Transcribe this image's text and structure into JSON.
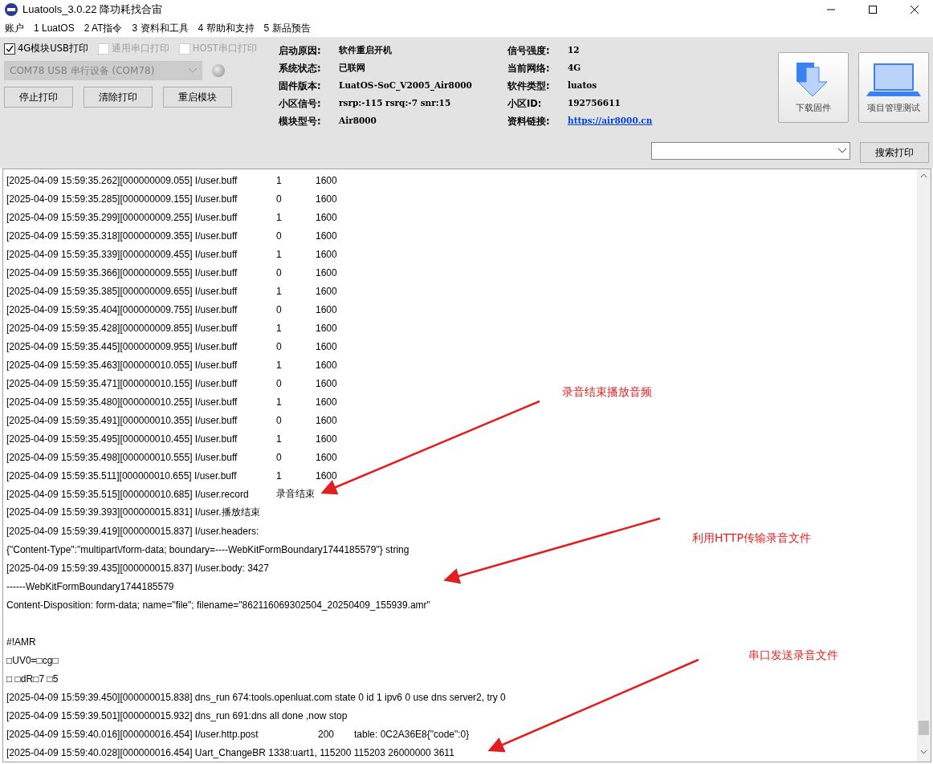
{
  "window": {
    "title": "Luatools_3.0.22 降功耗找合宙"
  },
  "menu": [
    "账户",
    "1 LuatOS",
    "2 AT指令",
    "3 资料和工具",
    "4 帮助和支持",
    "5 新品预告"
  ],
  "print_options": [
    {
      "label": "4G模块USB打印",
      "checked": true,
      "disabled": false
    },
    {
      "label": "通用串口打印",
      "checked": false,
      "disabled": true
    },
    {
      "label": "HOST串口打印",
      "checked": false,
      "disabled": true
    }
  ],
  "port_select": {
    "value": "COM78 USB 串行设备 (COM78)",
    "disabled": true
  },
  "buttons": [
    "停止打印",
    "清除打印",
    "重启模块"
  ],
  "info_left": [
    {
      "label": "启动原因:",
      "value": "软件重启开机"
    },
    {
      "label": "系统状态:",
      "value": "已联网"
    },
    {
      "label": "固件版本:",
      "value": "LuatOS-SoC_V2005_Air8000"
    },
    {
      "label": "小区信号:",
      "value": "rsrp:-115 rsrq:-7 snr:15"
    },
    {
      "label": "模块型号:",
      "value": "Air8000"
    }
  ],
  "info_right": [
    {
      "label": "信号强度:",
      "value": "12",
      "kind": "text"
    },
    {
      "label": "当前网络:",
      "value": "4G",
      "kind": "text"
    },
    {
      "label": "软件类型:",
      "value": "luatos",
      "kind": "text"
    },
    {
      "label": "小区ID:",
      "value": "192756611",
      "kind": "text"
    },
    {
      "label": "资料链接:",
      "value": "https://air8000.cn",
      "kind": "link"
    }
  ],
  "tool_buttons": [
    {
      "label": "下载固件",
      "kind": "download"
    },
    {
      "label": "项目管理测试",
      "kind": "laptop"
    }
  ],
  "search_button": "搜索打印",
  "log": [
    {
      "kind": "cols",
      "cells": [
        "[2025-04-09 15:59:35.262][000000009.055] I/user.buff",
        "1",
        "1600"
      ]
    },
    {
      "kind": "cols",
      "cells": [
        "[2025-04-09 15:59:35.285][000000009.155] I/user.buff",
        "0",
        "1600"
      ]
    },
    {
      "kind": "cols",
      "cells": [
        "[2025-04-09 15:59:35.299][000000009.255] I/user.buff",
        "1",
        "1600"
      ]
    },
    {
      "kind": "cols",
      "cells": [
        "[2025-04-09 15:59:35.318][000000009.355] I/user.buff",
        "0",
        "1600"
      ]
    },
    {
      "kind": "cols",
      "cells": [
        "[2025-04-09 15:59:35.339][000000009.455] I/user.buff",
        "1",
        "1600"
      ]
    },
    {
      "kind": "cols",
      "cells": [
        "[2025-04-09 15:59:35.366][000000009.555] I/user.buff",
        "0",
        "1600"
      ]
    },
    {
      "kind": "cols",
      "cells": [
        "[2025-04-09 15:59:35.385][000000009.655] I/user.buff",
        "1",
        "1600"
      ]
    },
    {
      "kind": "cols",
      "cells": [
        "[2025-04-09 15:59:35.404][000000009.755] I/user.buff",
        "0",
        "1600"
      ]
    },
    {
      "kind": "cols",
      "cells": [
        "[2025-04-09 15:59:35.428][000000009.855] I/user.buff",
        "1",
        "1600"
      ]
    },
    {
      "kind": "cols",
      "cells": [
        "[2025-04-09 15:59:35.445][000000009.955] I/user.buff",
        "0",
        "1600"
      ]
    },
    {
      "kind": "cols",
      "cells": [
        "[2025-04-09 15:59:35.463][000000010.055] I/user.buff",
        "1",
        "1600"
      ]
    },
    {
      "kind": "cols",
      "cells": [
        "[2025-04-09 15:59:35.471][000000010.155] I/user.buff",
        "0",
        "1600"
      ]
    },
    {
      "kind": "cols",
      "cells": [
        "[2025-04-09 15:59:35.480][000000010.255] I/user.buff",
        "1",
        "1600"
      ]
    },
    {
      "kind": "cols",
      "cells": [
        "[2025-04-09 15:59:35.491][000000010.355] I/user.buff",
        "0",
        "1600"
      ]
    },
    {
      "kind": "cols",
      "cells": [
        "[2025-04-09 15:59:35.495][000000010.455] I/user.buff",
        "1",
        "1600"
      ]
    },
    {
      "kind": "cols",
      "cells": [
        "[2025-04-09 15:59:35.498][000000010.555] I/user.buff",
        "0",
        "1600"
      ]
    },
    {
      "kind": "cols",
      "cells": [
        "[2025-04-09 15:59:35.511][000000010.655] I/user.buff",
        "1",
        "1600"
      ]
    },
    {
      "kind": "cols",
      "cells": [
        "[2025-04-09 15:59:35.515][000000010.685] I/user.record",
        "录音结束"
      ]
    },
    {
      "kind": "plain",
      "text": "[2025-04-09 15:59:39.393][000000015.831] I/user.播放结束"
    },
    {
      "kind": "plain",
      "text": "[2025-04-09 15:59:39.419][000000015.837] I/user.headers:"
    },
    {
      "kind": "plain",
      "text": "{\"Content-Type\":\"multipart\\/form-data; boundary=----WebKitFormBoundary1744185579\"}  string"
    },
    {
      "kind": "plain",
      "text": "[2025-04-09 15:59:39.435][000000015.837] I/user.body: 3427"
    },
    {
      "kind": "plain",
      "text": "------WebKitFormBoundary1744185579"
    },
    {
      "kind": "plain",
      "text": "Content-Disposition: form-data; name=\"file\"; filename=\"862116069302504_20250409_155939.amr\""
    },
    {
      "kind": "blank"
    },
    {
      "kind": "plain",
      "text": "#!AMR"
    },
    {
      "kind": "plain",
      "text": "□UV0=□cg□"
    },
    {
      "kind": "plain",
      "text": "□ □dR□7 □5"
    },
    {
      "kind": "plain",
      "text": "[2025-04-09 15:59:39.450][000000015.838] dns_run 674:tools.openluat.com state 0 id 1 ipv6 0 use dns server2, try 0"
    },
    {
      "kind": "plain",
      "text": "[2025-04-09 15:59:39.501][000000015.932] dns_run 691:dns all done ,now stop"
    },
    {
      "kind": "post",
      "cells": [
        "[2025-04-09 15:59:40.016][000000016.454] I/user.http.post",
        "200",
        "table: 0C2A36E8{\"code\":0}"
      ]
    },
    {
      "kind": "plain",
      "text": "[2025-04-09 15:59:40.028][000000016.454] Uart_ChangeBR 1338:uart1, 115200 115203 26000000 3611"
    }
  ],
  "annotations": [
    "录音结束播放音频",
    "利用HTTP传输录音文件",
    "串口发送录音文件"
  ]
}
